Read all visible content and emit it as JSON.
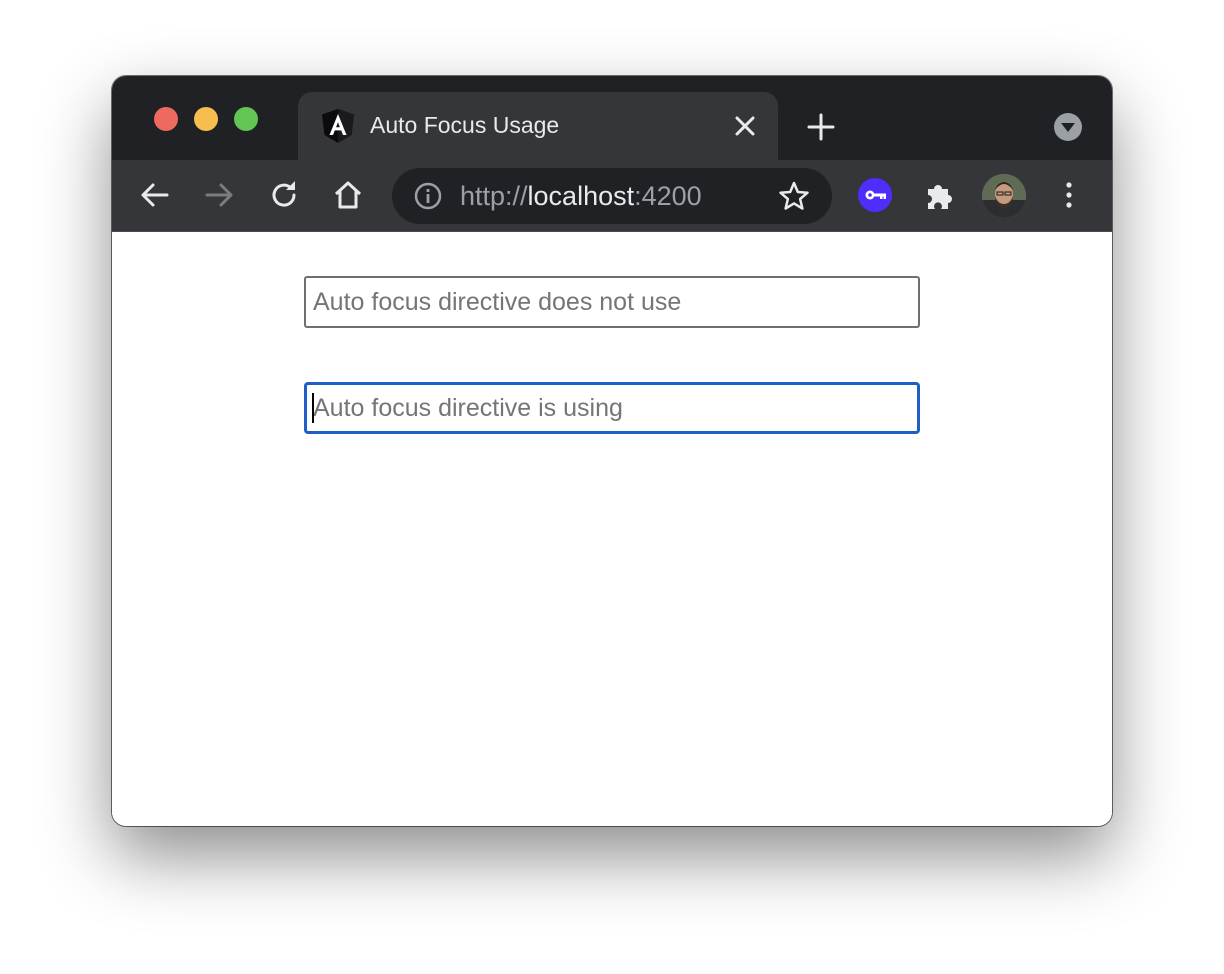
{
  "browser": {
    "tab": {
      "title": "Auto Focus Usage",
      "favicon": "angular-logo-icon"
    },
    "address_bar": {
      "scheme": "http://",
      "host": "localhost",
      "port": ":4200"
    },
    "icons": {
      "back": "arrow-left-icon",
      "forward": "arrow-right-icon",
      "reload": "reload-icon",
      "home": "home-icon",
      "info": "info-icon",
      "bookmark": "star-icon",
      "password_ext": "key-icon",
      "extensions": "puzzle-icon",
      "menu": "kebab-menu-icon"
    },
    "colors": {
      "titlebar": "#202124",
      "toolbar": "#35363a",
      "omnibox": "#202124",
      "focus_ring": "#1f5fc7",
      "ext_key_bg": "#4f2dfb"
    }
  },
  "page": {
    "input_without_directive": {
      "placeholder": "Auto focus directive does not use",
      "value": ""
    },
    "input_with_directive": {
      "placeholder": "Auto focus directive is using",
      "value": "",
      "focused": true
    }
  }
}
